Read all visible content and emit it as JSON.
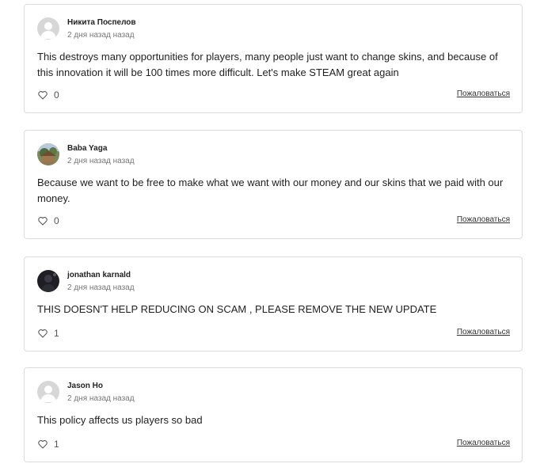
{
  "comments": [
    {
      "author": "Никита Поспелов",
      "time": "2 дня назад назад",
      "text": "This destroys many opportunities for players, many people just want to change skins, and because of this innovation it will be 100 times more difficult. Let's make STEAM great again",
      "likes": "0",
      "report_label": "Пожаловаться"
    },
    {
      "author": "Baba Yaga",
      "time": "2 дня назад назад",
      "text": "Because we want to be free to make what we want with our money and our skins that we paid with our money.",
      "likes": "0",
      "report_label": "Пожаловаться"
    },
    {
      "author": "jonathan karnald",
      "time": "2 дня назад назад",
      "text": "THIS DOESN'T HELP REDUCING ON SCAM , PLEASE REMOVE THE NEW UPDATE",
      "likes": "1",
      "report_label": "Пожаловаться"
    },
    {
      "author": "Jason Ho",
      "time": "2 дня назад назад",
      "text": "This policy affects us players so bad",
      "likes": "1",
      "report_label": "Пожаловаться"
    }
  ],
  "icons": {
    "like": "heart-outline-icon",
    "avatar_default": "user-silhouette-icon"
  },
  "colors": {
    "card_border": "#dcdcdc",
    "avatar_default": "#d7d7d7",
    "meta_text": "#777777"
  }
}
